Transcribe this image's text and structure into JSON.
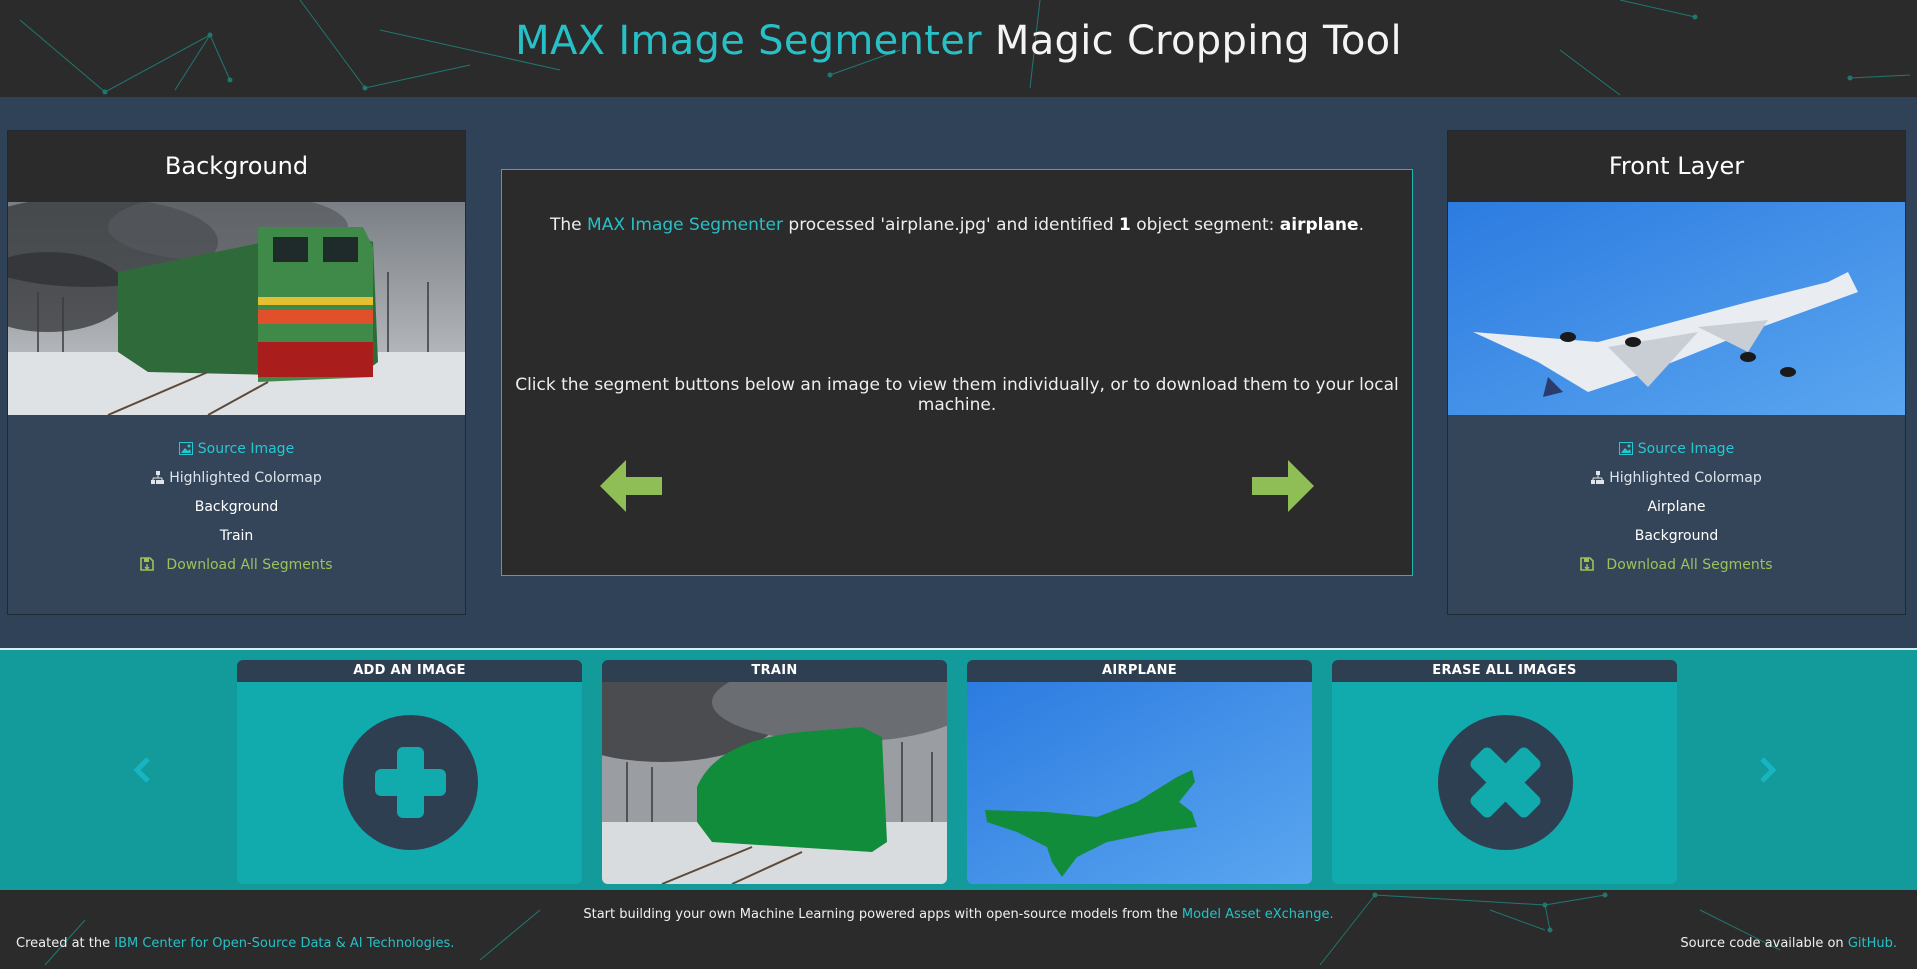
{
  "header": {
    "title_max": "MAX",
    "title_segmenter": "Image Segmenter",
    "title_rest": "Magic Cropping Tool"
  },
  "left_panel": {
    "title": "Background",
    "image_desc": "train",
    "links": {
      "source": "Source Image",
      "colormap": "Highlighted Colormap",
      "seg1": "Background",
      "seg2": "Train",
      "download": "Download All Segments"
    }
  },
  "right_panel": {
    "title": "Front Layer",
    "image_desc": "airplane",
    "links": {
      "source": "Source Image",
      "colormap": "Highlighted Colormap",
      "seg1": "Airplane",
      "seg2": "Background",
      "download": "Download All Segments"
    }
  },
  "center": {
    "msg_pre": "The ",
    "msg_model": "MAX Image Segmenter",
    "msg_mid": " processed 'airplane.jpg' and identified ",
    "msg_count": "1",
    "msg_mid2": " object segment: ",
    "msg_segment": "airplane",
    "msg_end": ".",
    "instructions": "Click the segment buttons below an image to view them individually, or to download them to your local machine."
  },
  "carousel": {
    "cards": [
      {
        "label": "ADD AN IMAGE"
      },
      {
        "label": "TRAIN"
      },
      {
        "label": "AIRPLANE"
      },
      {
        "label": "ERASE ALL IMAGES"
      }
    ],
    "prev_icon": "chevron-left-icon",
    "next_icon": "chevron-right-icon"
  },
  "footer": {
    "line1_pre": "Start building your own Machine Learning powered apps with open-source models from the ",
    "line1_link": "Model Asset eXchange.",
    "created_pre": "Created at the ",
    "created_link": "IBM Center for Open-Source Data & AI Technologies.",
    "source_pre": "Source code available on ",
    "source_link": "GitHub."
  },
  "colors": {
    "accent": "#27c0c7",
    "download_green": "#9ac25c",
    "arrow_green": "#8fbe57",
    "carousel_bg": "#139a9a",
    "mask_green": "#118c3a"
  }
}
